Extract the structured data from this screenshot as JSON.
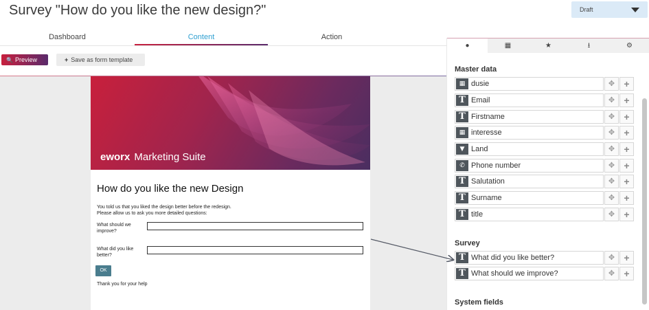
{
  "header": {
    "title": "Survey \"How do you like the new design?\"",
    "status_value": "Draft"
  },
  "tabs": [
    {
      "label": "Dashboard"
    },
    {
      "label": "Content"
    },
    {
      "label": "Action"
    }
  ],
  "toolbar": {
    "preview_label": "Preview",
    "save_template_label": "Save as form template"
  },
  "form": {
    "brand_bold": "eworx",
    "brand_rest": "Marketing Suite",
    "title": "How do you like the new Design",
    "intro_line1": "You told us that you liked the design better before the redesign.",
    "intro_line2": "Please allow us to ask you more detailed questions:",
    "q1_label": "What should we improve?",
    "q2_label": "What did you like better?",
    "ok_label": "OK",
    "thanks": "Thank you for your help"
  },
  "panel": {
    "master_title": "Master data",
    "master_fields": [
      {
        "label": "dusie",
        "icon": "list-icon"
      },
      {
        "label": "Email",
        "icon": "text-icon"
      },
      {
        "label": "Firstname",
        "icon": "text-icon"
      },
      {
        "label": "interesse",
        "icon": "list-icon"
      },
      {
        "label": "Land",
        "icon": "dropdown-icon"
      },
      {
        "label": "Phone number",
        "icon": "phone-icon"
      },
      {
        "label": "Salutation",
        "icon": "text-icon"
      },
      {
        "label": "Surname",
        "icon": "text-icon"
      },
      {
        "label": "title",
        "icon": "text-icon"
      }
    ],
    "survey_title": "Survey",
    "survey_fields": [
      {
        "label": "What did you like better?",
        "icon": "text-icon"
      },
      {
        "label": "What should we improve?",
        "icon": "text-icon"
      }
    ],
    "system_title": "System fields"
  },
  "colors": {
    "accent_blue": "#2e9fd1",
    "accent_red": "#c7203e",
    "icon_dark": "#4f565c",
    "status_bg": "#dbeaf7"
  }
}
